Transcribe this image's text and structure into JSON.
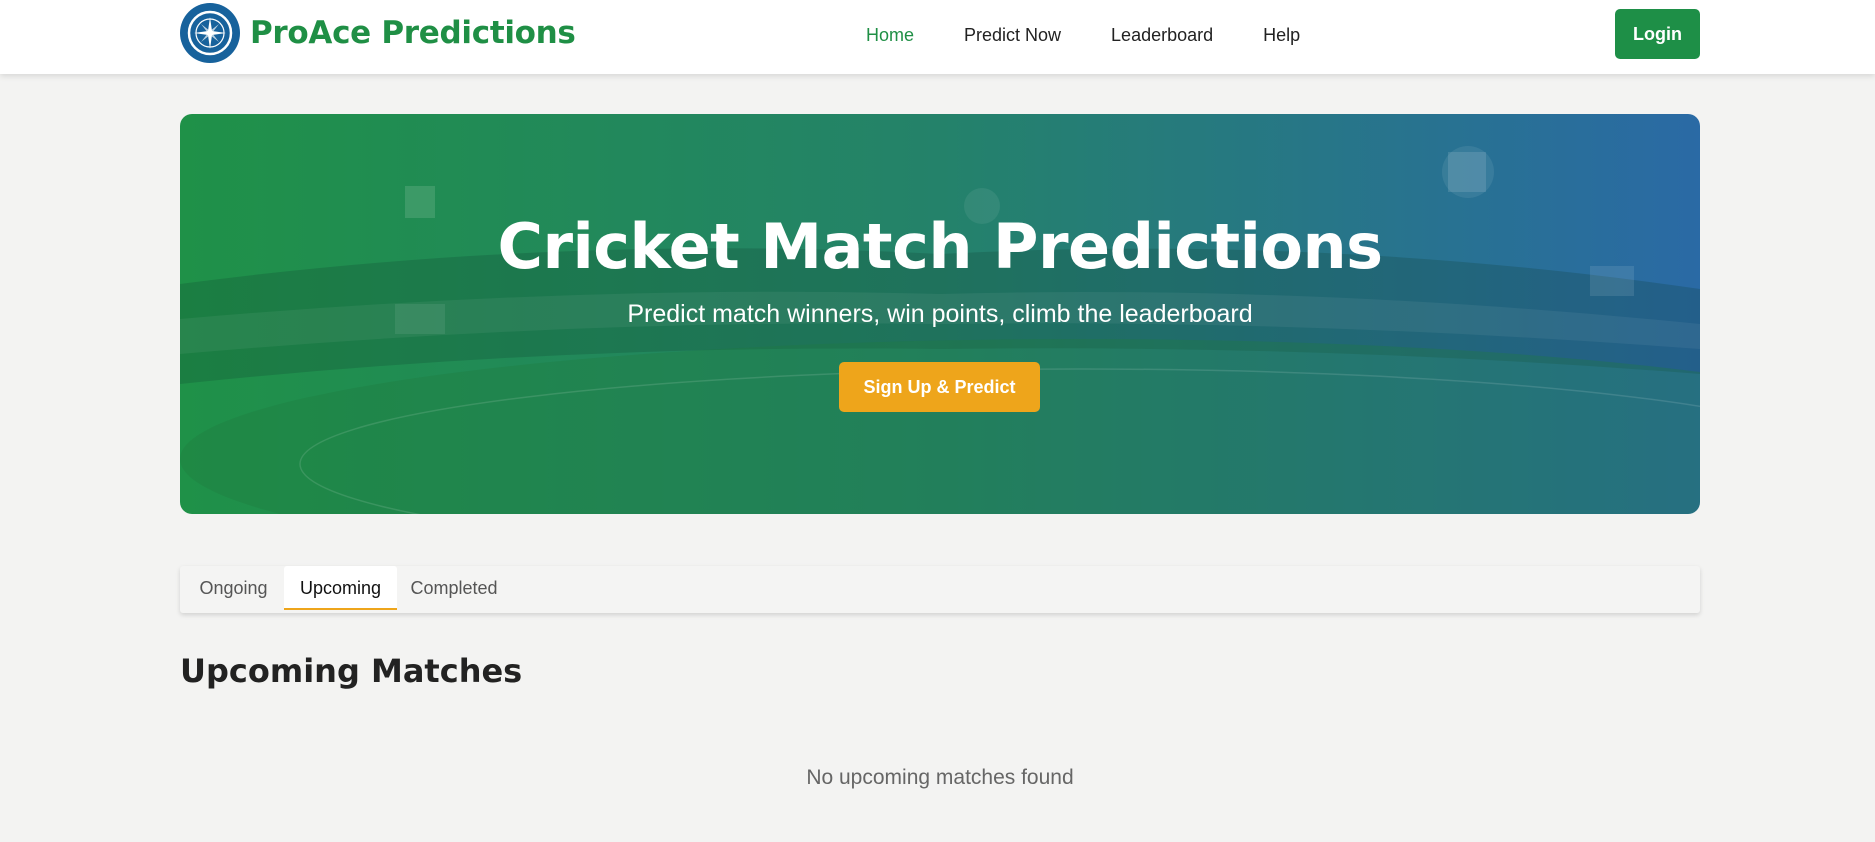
{
  "header": {
    "brand_name": "ProAce Predictions",
    "logo_icon": "compass-icon",
    "nav": [
      {
        "label": "Home",
        "active": true
      },
      {
        "label": "Predict Now",
        "active": false
      },
      {
        "label": "Leaderboard",
        "active": false
      },
      {
        "label": "Help",
        "active": false
      }
    ],
    "login_label": "Login"
  },
  "hero": {
    "title": "Cricket Match Predictions",
    "subtitle": "Predict match winners, win points, climb the leaderboard",
    "cta_label": "Sign Up & Predict"
  },
  "tabs": [
    {
      "label": "Ongoing",
      "active": false
    },
    {
      "label": "Upcoming",
      "active": true
    },
    {
      "label": "Completed",
      "active": false
    }
  ],
  "main": {
    "section_title": "Upcoming Matches",
    "empty_message": "No upcoming matches found"
  },
  "colors": {
    "brand_green": "#1f8f45",
    "hero_gradient_start": "#1f9148",
    "hero_gradient_end": "#2a6aa5",
    "cta_orange": "#eea51b",
    "logo_blue": "#17629c"
  }
}
